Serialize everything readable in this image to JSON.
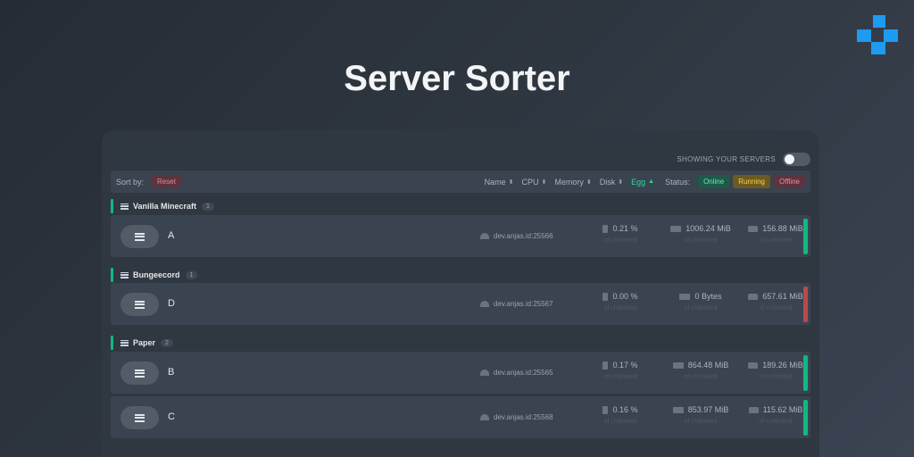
{
  "header": {
    "title": "Server Sorter",
    "logo_icon": "logo-icon"
  },
  "toggle": {
    "label": "SHOWING YOUR SERVERS",
    "state": "off"
  },
  "sortbar": {
    "label": "Sort by:",
    "reset": "Reset",
    "fields": [
      "Name",
      "CPU",
      "Memory",
      "Disk",
      "Egg"
    ],
    "active_field": "Egg",
    "status_label": "Status:",
    "statuses": [
      "Online",
      "Running",
      "Offline"
    ]
  },
  "colors": {
    "accent": "#10b981",
    "online": "#10b981",
    "offline": "#ef4444",
    "brand": "#1d9bf0"
  },
  "groups": [
    {
      "name": "Vanilla Minecraft",
      "count": "1",
      "servers": [
        {
          "name": "A",
          "address": "dev.anjas.id:25566",
          "cpu": "0.21 %",
          "cpu_limit": "of Unlimited",
          "memory": "1006.24 MiB",
          "memory_limit": "of Unlimited",
          "disk": "156.88 MiB",
          "disk_limit": "of Unlimited",
          "status": "online"
        }
      ]
    },
    {
      "name": "Bungeecord",
      "count": "1",
      "servers": [
        {
          "name": "D",
          "address": "dev.anjas.id:25567",
          "cpu": "0.00 %",
          "cpu_limit": "of Unlimited",
          "memory": "0 Bytes",
          "memory_limit": "of Unlimited",
          "disk": "657.61 MiB",
          "disk_limit": "of Unlimited",
          "status": "offline"
        }
      ]
    },
    {
      "name": "Paper",
      "count": "2",
      "servers": [
        {
          "name": "B",
          "address": "dev.anjas.id:25565",
          "cpu": "0.17 %",
          "cpu_limit": "of Unlimited",
          "memory": "864.48 MiB",
          "memory_limit": "of Unlimited",
          "disk": "189.26 MiB",
          "disk_limit": "of Unlimited",
          "status": "online"
        },
        {
          "name": "C",
          "address": "dev.anjas.id:25568",
          "cpu": "0.16 %",
          "cpu_limit": "of Unlimited",
          "memory": "853.97 MiB",
          "memory_limit": "of Unlimited",
          "disk": "115.62 MiB",
          "disk_limit": "of Unlimited",
          "status": "online"
        }
      ]
    }
  ]
}
